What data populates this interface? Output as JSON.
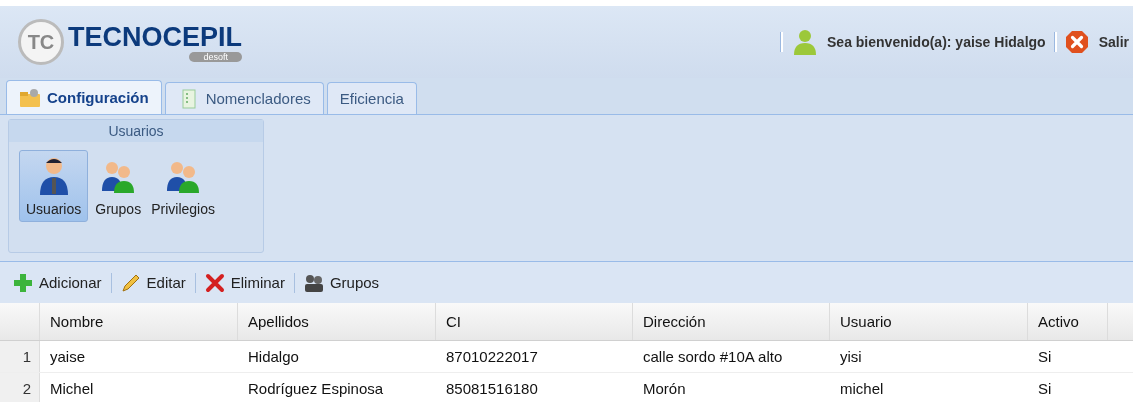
{
  "logo": {
    "mark": "TC",
    "name": "TECNOCEPIL",
    "subtitle": "desoft"
  },
  "header": {
    "welcome": "Sea bienvenido(a): yaise Hidalgo",
    "logout": "Salir"
  },
  "tabs": [
    {
      "label": "Configuración",
      "selected": true,
      "kind": "folder"
    },
    {
      "label": "Nomencladores",
      "selected": false,
      "kind": "list"
    },
    {
      "label": "Eficiencia",
      "selected": false
    }
  ],
  "ribbon_group": {
    "title": "Usuarios",
    "buttons": [
      {
        "label": "Usuarios",
        "kind": "single",
        "selected": true
      },
      {
        "label": "Grupos",
        "kind": "pair",
        "selected": false
      },
      {
        "label": "Privilegios",
        "kind": "pair",
        "selected": false
      }
    ]
  },
  "toolbar": [
    {
      "label": "Adicionar",
      "kind": "add"
    },
    {
      "label": "Editar",
      "kind": "edit"
    },
    {
      "label": "Eliminar",
      "kind": "delete"
    },
    {
      "label": "Grupos",
      "kind": "group"
    }
  ],
  "table": {
    "columns": [
      "Nombre",
      "Apellidos",
      "CI",
      "Dirección",
      "Usuario",
      "Activo"
    ],
    "rows": [
      {
        "number": "1",
        "cells": [
          "yaise",
          "Hidalgo",
          "87010222017",
          "calle sordo #10A alto",
          "yisi",
          "Si"
        ]
      },
      {
        "number": "2",
        "cells": [
          "Michel",
          "Rodríguez Espinosa",
          "85081516180",
          "Morón",
          "michel",
          "Si"
        ]
      }
    ]
  }
}
